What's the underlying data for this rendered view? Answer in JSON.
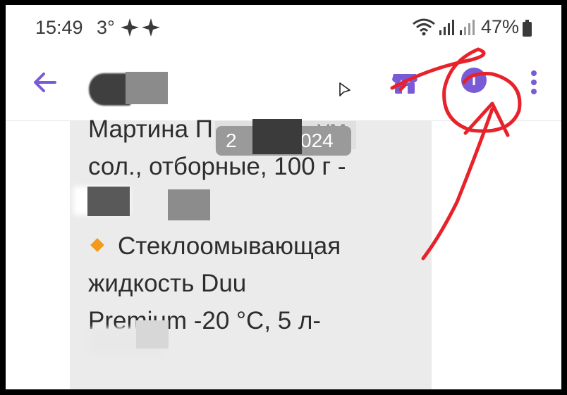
{
  "status_bar": {
    "time": "15:49",
    "temperature": "3°",
    "battery": "47%",
    "icons": [
      "sparkle-icon",
      "wifi-icon",
      "signal-icon",
      "signal-icon",
      "battery-icon"
    ]
  },
  "app_bar": {
    "back_icon": "arrow-left-icon",
    "store_icon": "store-icon",
    "info_label": "i",
    "more_icon": "more-vertical-icon",
    "accent_color": "#7a5bd6"
  },
  "message": {
    "lines": [
      "Мартина П",
      "сол., отборные, 100 г -",
      "Стеклоомывающая",
      "жидкость Duu",
      "Premium -20 °C, 5 л-"
    ],
    "partial_text": "ум",
    "date_left": "2",
    "date_right": "024",
    "bullet_color": "#f39a1b"
  }
}
